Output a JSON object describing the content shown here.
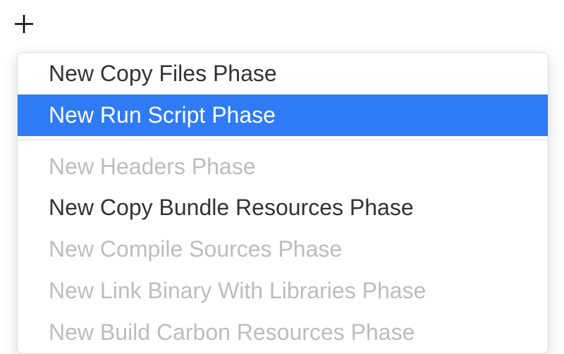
{
  "menu": {
    "items": [
      {
        "label": "New Copy Files Phase",
        "state": "enabled"
      },
      {
        "label": "New Run Script Phase",
        "state": "selected"
      },
      {
        "label": "New Headers Phase",
        "state": "disabled"
      },
      {
        "label": "New Copy Bundle Resources Phase",
        "state": "enabled"
      },
      {
        "label": "New Compile Sources Phase",
        "state": "disabled"
      },
      {
        "label": "New Link Binary With Libraries Phase",
        "state": "disabled"
      },
      {
        "label": "New Build Carbon Resources Phase",
        "state": "disabled"
      }
    ]
  }
}
